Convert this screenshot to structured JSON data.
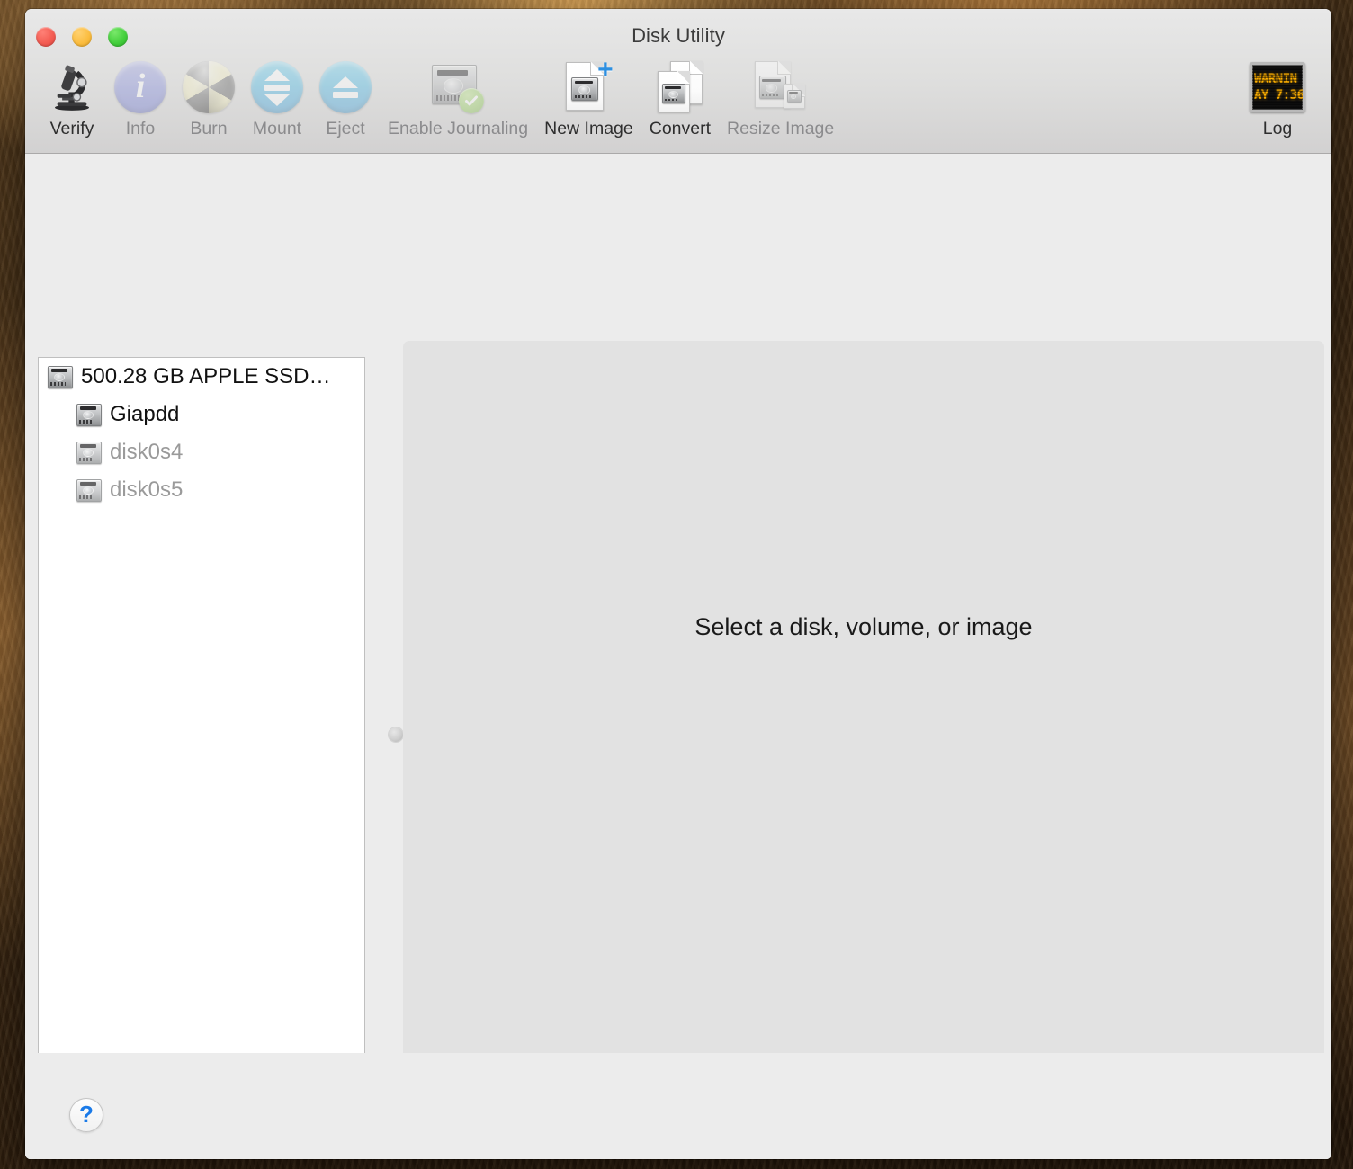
{
  "window": {
    "title": "Disk Utility",
    "traffic_lights": [
      "close",
      "minimize",
      "zoom"
    ]
  },
  "toolbar": {
    "items": [
      {
        "label": "Verify",
        "icon": "microscope-icon",
        "enabled": true
      },
      {
        "label": "Info",
        "icon": "info-circle-icon",
        "enabled": false
      },
      {
        "label": "Burn",
        "icon": "burn-disc-icon",
        "enabled": false
      },
      {
        "label": "Mount",
        "icon": "mount-icon",
        "enabled": false
      },
      {
        "label": "Eject",
        "icon": "eject-icon",
        "enabled": false
      },
      {
        "label": "Enable Journaling",
        "icon": "journaling-disk-icon",
        "enabled": false
      },
      {
        "label": "New Image",
        "icon": "new-image-document-icon",
        "enabled": true
      },
      {
        "label": "Convert",
        "icon": "convert-documents-icon",
        "enabled": true
      },
      {
        "label": "Resize Image",
        "icon": "resize-image-icon",
        "enabled": false
      }
    ],
    "log": {
      "label": "Log",
      "icon": "log-display-icon",
      "screen_line_1": "WARNIN",
      "screen_line_2": "AY 7:36",
      "screen_text_color": "#ffb000",
      "screen_bg_color": "#101010"
    }
  },
  "sidebar": {
    "items": [
      {
        "label": "500.28 GB APPLE SSD…",
        "icon": "hard-disk-icon",
        "level": 0,
        "dimmed": false
      },
      {
        "label": "Giapdd",
        "icon": "hard-disk-icon",
        "level": 1,
        "dimmed": false
      },
      {
        "label": "disk0s4",
        "icon": "hard-disk-icon",
        "level": 1,
        "dimmed": true
      },
      {
        "label": "disk0s5",
        "icon": "hard-disk-icon",
        "level": 1,
        "dimmed": true
      }
    ]
  },
  "main": {
    "placeholder": "Select a disk, volume, or image"
  },
  "footer": {
    "help_label": "?"
  },
  "colors": {
    "accent_blue": "#1a7ae8",
    "toolbar_bg": "#dededd",
    "window_bg": "#ececec",
    "panel_bg": "#e2e2e2",
    "sidebar_bg": "#ffffff",
    "disabled_text": "#8b8b8d",
    "enabled_text": "#2e2e2e"
  }
}
